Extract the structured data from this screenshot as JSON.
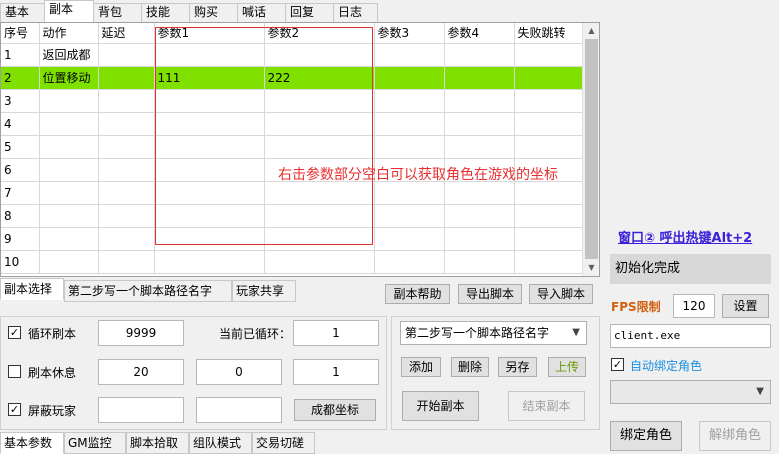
{
  "top_tabs": [
    "基本",
    "副本",
    "背包",
    "技能",
    "购买",
    "喊话",
    "回复",
    "日志"
  ],
  "grid": {
    "columns": [
      "序号",
      "动作",
      "延迟",
      "参数1",
      "参数2",
      "参数3",
      "参数4",
      "失败跳转"
    ],
    "rows": [
      [
        "1",
        "返回成都",
        "",
        "",
        "",
        "",
        "",
        ""
      ],
      [
        "2",
        "位置移动",
        "",
        "111",
        "222",
        "",
        "",
        ""
      ],
      [
        "3",
        "",
        "",
        "",
        "",
        "",
        "",
        ""
      ],
      [
        "4",
        "",
        "",
        "",
        "",
        "",
        "",
        ""
      ],
      [
        "5",
        "",
        "",
        "",
        "",
        "",
        "",
        ""
      ],
      [
        "6",
        "",
        "",
        "",
        "",
        "",
        "",
        ""
      ],
      [
        "7",
        "",
        "",
        "",
        "",
        "",
        "",
        ""
      ],
      [
        "8",
        "",
        "",
        "",
        "",
        "",
        "",
        ""
      ],
      [
        "9",
        "",
        "",
        "",
        "",
        "",
        "",
        ""
      ],
      [
        "10",
        "",
        "",
        "",
        "",
        "",
        "",
        ""
      ]
    ],
    "selected_row": 1,
    "annotation": "右击参数部分空白可以获取角色在游戏的坐标"
  },
  "mid_tabs": [
    "副本选择",
    "第二步写一个脚本路径名字",
    "玩家共享"
  ],
  "mid_buttons": {
    "help": "副本帮助",
    "export": "导出脚本",
    "import": "导入脚本"
  },
  "options": {
    "loop_label": "循环刷本",
    "loop_count": "9999",
    "current_loop_label": "当前已循环：",
    "current_loop_value": "1",
    "rest_label": "刷本休息",
    "rest_val1": "20",
    "rest_val2": "0",
    "rest_val3": "1",
    "block_label": "屏蔽玩家",
    "chengdu_coords_button": "成都坐标"
  },
  "script_panel": {
    "selected_script": "第二步写一个脚本路径名字",
    "add": "添加",
    "delete": "删除",
    "save_as": "另存",
    "upload": "上传",
    "start": "开始副本",
    "stop": "结束副本"
  },
  "bottom_tabs": [
    "基本参数",
    "GM监控",
    "脚本拾取",
    "组队模式",
    "交易切磋"
  ],
  "right": {
    "hotkey": "窗口② 呼出热键Alt+2",
    "status": "初始化完成",
    "fps_label": "FPS限制",
    "fps_value": "120",
    "set_button": "设置",
    "process_name": "client.exe",
    "auto_bind_label": "自动绑定角色",
    "bind_button": "绑定角色",
    "unbind_button": "解绑角色"
  },
  "colors": {
    "selected_row": "#80e000",
    "annotation": "#e83030",
    "hotkey": "#3a20d8",
    "fps": "#d06010",
    "auto_bind": "#1a8fe0"
  }
}
